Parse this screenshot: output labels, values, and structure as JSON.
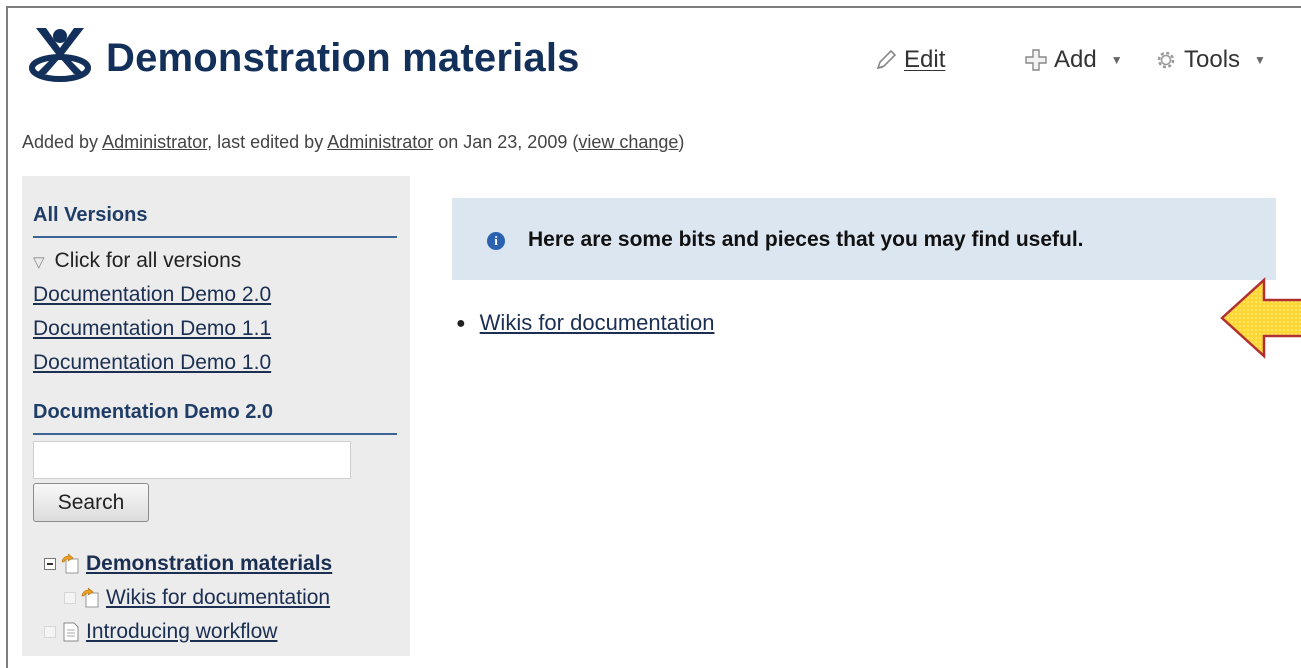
{
  "page": {
    "title": "Demonstration materials"
  },
  "toolbar": {
    "edit_label": "Edit",
    "add_label": "Add",
    "tools_label": "Tools"
  },
  "byline": {
    "added_by_prefix": "Added by ",
    "added_by_user": "Administrator",
    "edited_prefix": ", last edited by ",
    "edited_by_user": "Administrator",
    "date_text": " on Jan 23, 2009  (",
    "view_change": "view change",
    "close_paren": ")"
  },
  "sidebar": {
    "versions_heading": "All Versions",
    "click_all": "Click for all versions",
    "version_links": [
      "Documentation Demo 2.0",
      "Documentation Demo 1.1",
      "Documentation Demo 1.0"
    ],
    "space_heading": "Documentation Demo 2.0",
    "search_value": "",
    "search_button": "Search",
    "tree": [
      {
        "label": "Demonstration materials",
        "current": true
      },
      {
        "label": "Wikis for documentation"
      },
      {
        "label": "Introducing workflow"
      }
    ]
  },
  "main": {
    "info_message": "Here are some bits and pieces that you may find useful.",
    "links": [
      "Wikis for documentation"
    ]
  },
  "colors": {
    "title": "#13305a",
    "info_background": "#dce6f1",
    "arrow_fill": "#ffd733",
    "arrow_stroke": "#b03030"
  },
  "icons": {
    "logo": "confluence-logo-icon",
    "edit": "pencil-icon",
    "add": "plus-icon",
    "tools": "gear-icon",
    "info": "info-icon",
    "tree_page": "page-icon",
    "annotation": "left-arrow-icon"
  }
}
